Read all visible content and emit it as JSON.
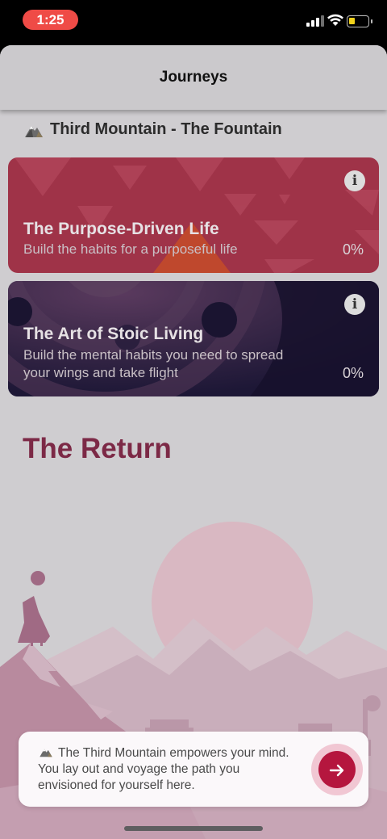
{
  "status_bar": {
    "time": "1:25"
  },
  "nav": {
    "title": "Journeys"
  },
  "section": {
    "title": "Third Mountain - The Fountain",
    "icon": "mountain-icon"
  },
  "cards": [
    {
      "title": "The Purpose-Driven Life",
      "description": "Build the habits for a purposeful life",
      "progress": "0%",
      "color": "#9f3348"
    },
    {
      "title": "The Art of Stoic Living",
      "description": "Build the mental habits you need to spread your wings and take flight",
      "progress": "0%",
      "color": "#1d1736"
    }
  ],
  "return_section": {
    "title": "The Return"
  },
  "toast": {
    "text": "The Third Mountain empowers your mind. You lay out and voyage the path you envisioned for yourself here.",
    "button_icon": "arrow-right-icon",
    "accent": "#b5163e"
  }
}
